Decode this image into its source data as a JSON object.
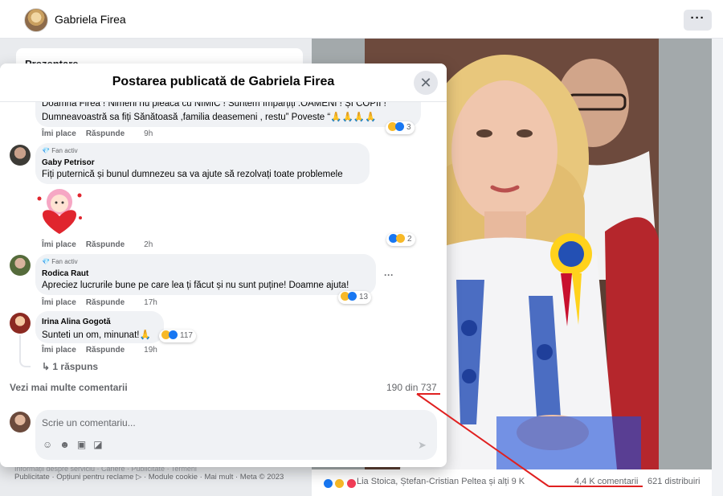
{
  "page": {
    "name": "Gabriela Firea",
    "more_label": "···",
    "section_title": "Prezentare",
    "footer_text": "Publicitate · Opțiuni pentru reclame ▷ · Module cookie · Mai mult · Meta © 2023",
    "footer_overlap_text": "Informații despre serviciu · Cariere · Publicitate · Termeni"
  },
  "modal": {
    "title": "Postarea publicată de Gabriela Firea",
    "close_label": "✕",
    "comments": [
      {
        "text_line1": "Doamna Firea ! Nimeni nu pleacă cu NIMIC ! Suntem împărțiți :OAMENI ! ȘI COPII !",
        "text_line2": "Dumneavoastră sa fiți Sănătoasă ,familia deasemeni , restu” Poveste “🙏🙏🙏🙏",
        "like": "Îmi place",
        "reply": "Răspunde",
        "time": "9h",
        "reaction_count": "3"
      },
      {
        "badge": "Fan activ",
        "name": "Gaby Petrisor",
        "text": "Fiți puternică și bunul dumnezeu sa va ajute să rezolvați toate problemele",
        "like": "Îmi place",
        "reply": "Răspunde",
        "time": "2h",
        "reaction_count": "2"
      },
      {
        "badge": "Fan activ",
        "name": "Rodica Raut",
        "text": "Apreciez lucrurile bune pe care lea ți făcut și nu sunt puține! Doamne ajuta!",
        "like": "Îmi place",
        "reply": "Răspunde",
        "time": "17h",
        "reaction_count": "13",
        "more": "···"
      },
      {
        "name": "Irina Alina Gogotă",
        "text": "Sunteti un om, minunat!🙏",
        "like": "Îmi place",
        "reply": "Răspunde",
        "time": "19h",
        "reaction_count": "117",
        "replies_label": "1 răspuns"
      }
    ],
    "see_more": "Vezi mai multe comentarii",
    "count": "190 din 737",
    "comment_placeholder": "Scrie un comentariu...",
    "composer_icons": [
      "sticker-smile-icon",
      "emoji-icon",
      "gif-icon",
      "sticker-icon"
    ],
    "send_icon": "➤"
  },
  "post": {
    "reactions": [
      "like",
      "haha",
      "love"
    ],
    "reaction_names": "Lia Stoica, Ștefan-Cristian Peltea și alți 9 K",
    "comments": "4,4 K comentarii",
    "shares": "621 distribuiri"
  },
  "colors": {
    "annotation": "#e02020",
    "like": "#1877f2",
    "haha": "#f7b928",
    "love": "#f33e58"
  }
}
